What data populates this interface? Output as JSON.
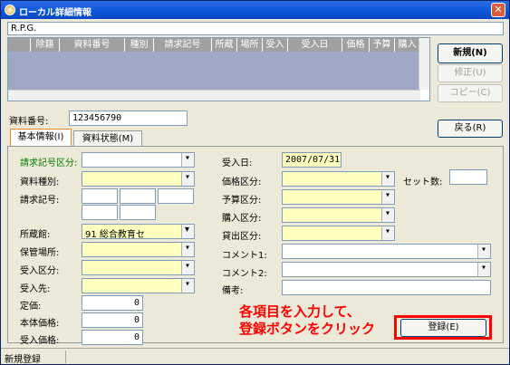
{
  "window": {
    "title": "ローカル詳細情報"
  },
  "top_field": "R.P.G.",
  "grid": {
    "columns": [
      "",
      "除籍",
      "資料番号",
      "種別",
      "請求記号",
      "所蔵",
      "場所",
      "受入",
      "受入日",
      "価格",
      "予算",
      "購入"
    ]
  },
  "buttons": {
    "new": "新規(N)",
    "edit": "修正(U)",
    "copy": "コピー(C)",
    "back": "戻る(R)",
    "register": "登録(E)"
  },
  "shiryo": {
    "label": "資料番号:",
    "value": "123456790"
  },
  "tabs": {
    "basic": "基本情報(I)",
    "status": "資料状態(M)"
  },
  "left": {
    "seikyu_kubun": "請求記号区分:",
    "shubetsu": "資料種別:",
    "seikyu_kigo": "請求記号:",
    "shozokan": "所蔵館:",
    "shozokan_value": "91 総合教育セ",
    "hokan": "保管場所:",
    "ukeire_kubun": "受入区分:",
    "ukeire_saki": "受入先:",
    "teika": "定価:",
    "teika_value": "0",
    "hontai": "本体価格:",
    "hontai_value": "0",
    "ukeire_kakaku": "受入価格:",
    "ukeire_kakaku_value": "0"
  },
  "right": {
    "ukeire_bi": "受入日:",
    "ukeire_bi_value": "2007/07/31",
    "kakaku_kubun": "価格区分:",
    "set_su": "セット数:",
    "yosan": "予算区分:",
    "konyu": "購入区分:",
    "kashidashi": "貸出区分:",
    "comment1": "コメント1:",
    "comment2": "コメント2:",
    "biko": "備考:"
  },
  "note": {
    "line1": "各項目を入力して、",
    "line2": "登録ボタンをクリック"
  },
  "status": "新規登録",
  "colors": {
    "title_bar": "#0A55D8",
    "accent_red": "#FF0000",
    "required_green": "#008000"
  }
}
